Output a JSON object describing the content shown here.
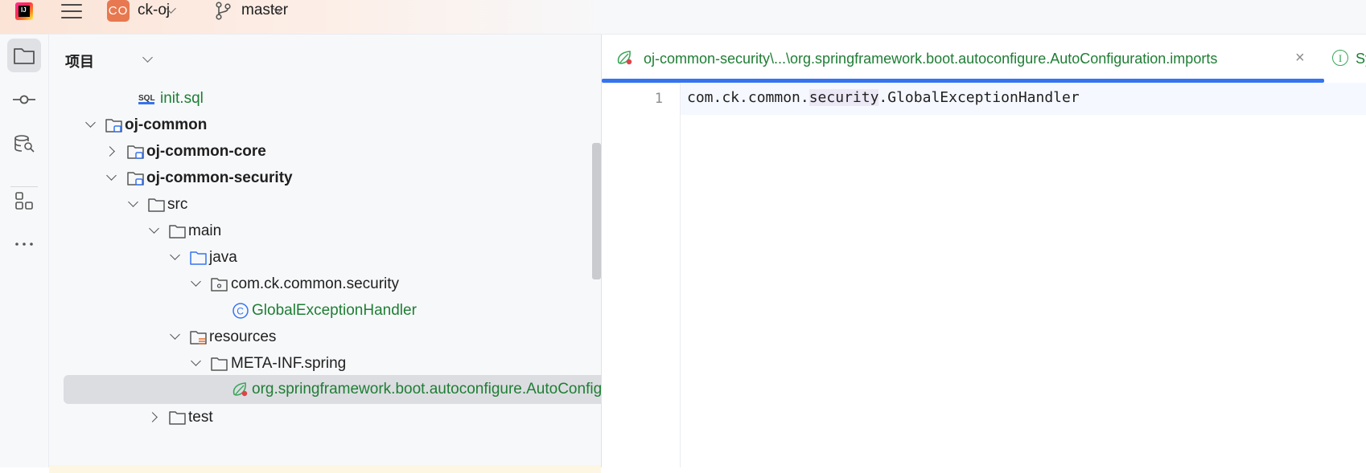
{
  "topbar": {
    "project_initials": "CO",
    "project_name": "ck-oj",
    "branch_name": "master"
  },
  "project_panel": {
    "title": "项目",
    "tree": [
      {
        "label": "init.sql",
        "style": "green",
        "icon": "sql-file-icon"
      },
      {
        "label": "oj-common",
        "style": "bold",
        "icon": "module-folder-icon",
        "expanded": true
      },
      {
        "label": "oj-common-core",
        "style": "bold",
        "icon": "module-folder-icon",
        "expanded": false
      },
      {
        "label": "oj-common-security",
        "style": "bold",
        "icon": "module-folder-icon",
        "expanded": true
      },
      {
        "label": "src",
        "icon": "folder-icon",
        "expanded": true
      },
      {
        "label": "main",
        "icon": "folder-icon",
        "expanded": true
      },
      {
        "label": "java",
        "icon": "source-folder-icon",
        "expanded": true
      },
      {
        "label": "com.ck.common.security",
        "icon": "package-icon",
        "expanded": true
      },
      {
        "label": "GlobalExceptionHandler",
        "style": "green",
        "icon": "class-icon"
      },
      {
        "label": "resources",
        "icon": "resources-folder-icon",
        "expanded": true
      },
      {
        "label": "META-INF.spring",
        "icon": "folder-icon",
        "expanded": true
      },
      {
        "label": "org.springframework.boot.autoconfigure.AutoConfiguration.imports",
        "style": "green",
        "icon": "spring-file-icon",
        "selected": true
      },
      {
        "label": "test",
        "icon": "folder-icon",
        "expanded": false
      }
    ]
  },
  "editor": {
    "active_tab": "oj-common-security\\...\\org.springframework.boot.autoconfigure.AutoConfiguration.imports",
    "second_tab": "Sy",
    "line_number": "1",
    "code_before": "com.ck.common.",
    "code_highlight": "security",
    "code_after": ".GlobalExceptionHandler"
  },
  "colors": {
    "accent": "#3574f0",
    "green_text": "#1e7e34",
    "project_badge": "#e8784f",
    "selection": "#dcdde1"
  }
}
